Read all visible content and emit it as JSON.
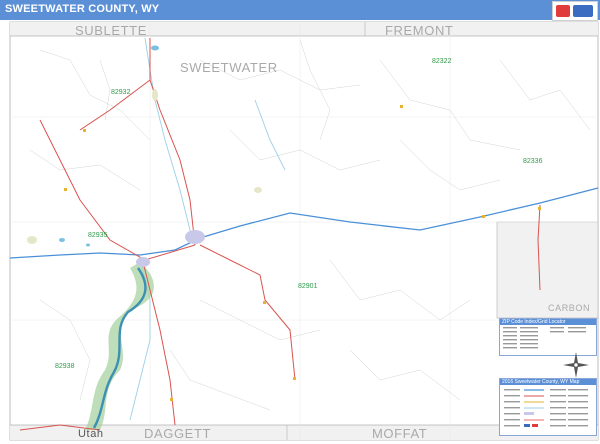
{
  "header": {
    "title": "SWEETWATER COUNTY, WY",
    "logo_icon": "marketmaps-logo-icon"
  },
  "map": {
    "colors": {
      "header_bg": "#5b8fd6",
      "road": "#d9534f",
      "highway": "#4a90d9",
      "river": "#9bd0e6",
      "reservoir": "#3d8fb5",
      "reservoir_buffer": "#a7d3a0",
      "city": "#c8c8e8",
      "zip_label": "#2e9b4a",
      "boundary": "#b0b0b0"
    },
    "region_labels": {
      "sublette": "SUBLETTE",
      "fremont": "FREMONT",
      "sweetwater": "SWEETWATER",
      "daggett": "DAGGETT",
      "moffat": "MOFFAT",
      "utah": "Utah",
      "carbon": "CARBON"
    },
    "zip_labels": {
      "z82322": "82322",
      "z82932": "82932",
      "z82336": "82336",
      "z82935": "82935",
      "z82901": "82901",
      "z82938": "82938"
    }
  },
  "inset": {
    "zip_table_title": "ZIP Code Index/Grid Locator",
    "legend_title": "2016 Sweetwater County, WY Map",
    "compass_icon": "compass-rose-icon"
  }
}
